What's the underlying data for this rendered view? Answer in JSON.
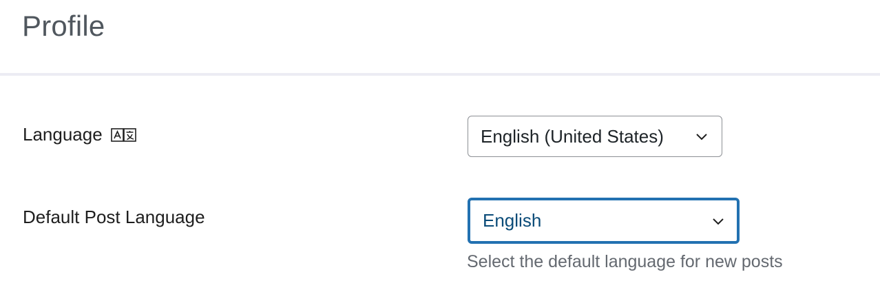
{
  "header": {
    "title": "Profile"
  },
  "settings": {
    "language": {
      "label": "Language",
      "icon": "translate-icon",
      "selected": "English (United States)"
    },
    "default_post_language": {
      "label": "Default Post Language",
      "selected": "English",
      "help_text": "Select the default language for new posts"
    }
  },
  "colors": {
    "focus_border": "#2271b1",
    "select_border": "#8c8f94",
    "title_text": "#50575e",
    "help_text": "#646970",
    "divider": "#ececf3"
  }
}
